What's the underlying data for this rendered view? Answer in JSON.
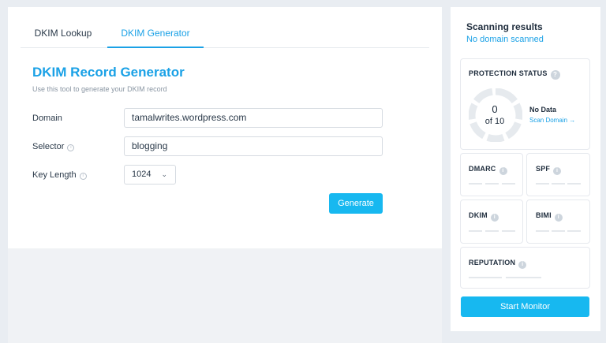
{
  "tabs": [
    {
      "label": "DKIM Lookup"
    },
    {
      "label": "DKIM Generator"
    }
  ],
  "generator": {
    "title": "DKIM Record Generator",
    "subtitle": "Use this tool to generate your DKIM record",
    "domain_label": "Domain",
    "domain_value": "tamalwrites.wordpress.com",
    "selector_label": "Selector",
    "selector_value": "blogging",
    "key_length_label": "Key Length",
    "key_length_value": "1024",
    "generate_label": "Generate"
  },
  "sidebar": {
    "title": "Scanning results",
    "subtitle": "No domain scanned",
    "protection": {
      "title": "PROTECTION STATUS",
      "score": "0",
      "score_of": "of 10",
      "status": "No Data",
      "scan_link": "Scan Domain →"
    },
    "cards": {
      "dmarc": "DMARC",
      "spf": "SPF",
      "dkim": "DKIM",
      "bimi": "BIMI",
      "reputation": "REPUTATION"
    },
    "monitor_label": "Start Monitor"
  },
  "colors": {
    "accent": "#1aa1e6",
    "button": "#17b8f0",
    "background": "#e9edf2"
  }
}
